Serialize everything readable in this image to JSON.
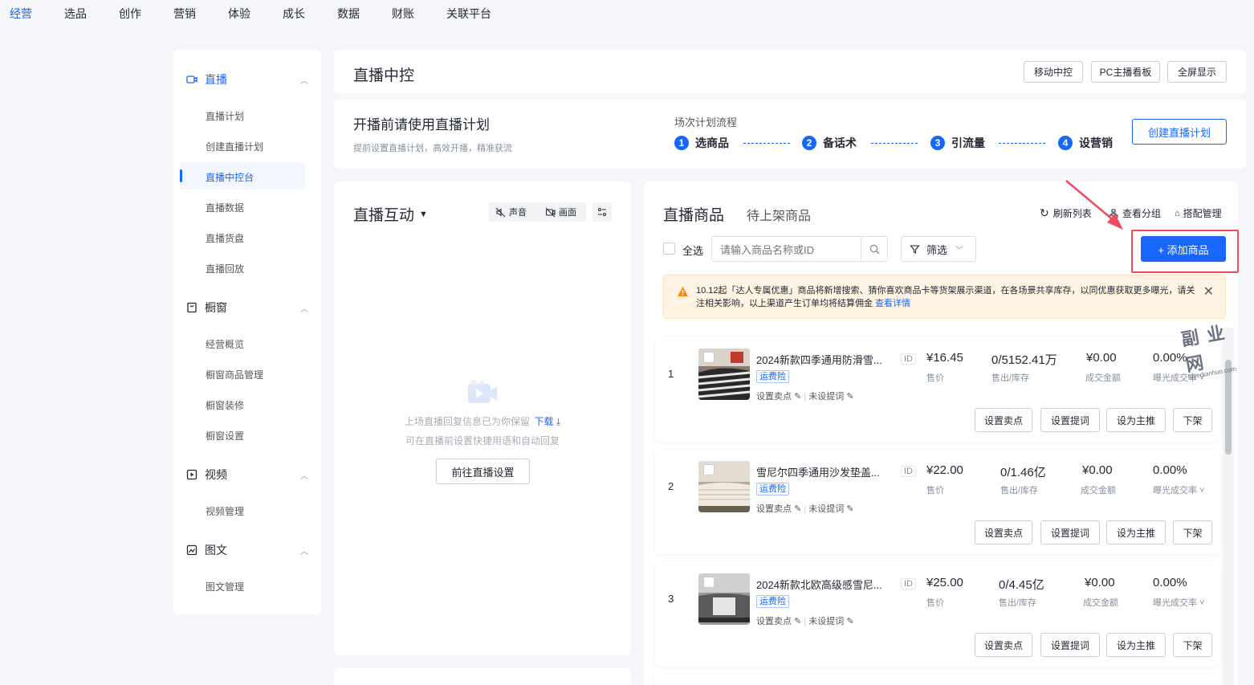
{
  "topnav": {
    "items": [
      {
        "label": "经营",
        "active": true
      },
      {
        "label": "选品"
      },
      {
        "label": "创作"
      },
      {
        "label": "营销"
      },
      {
        "label": "体验"
      },
      {
        "label": "成长"
      },
      {
        "label": "数据"
      },
      {
        "label": "财账"
      },
      {
        "label": "关联平台"
      }
    ]
  },
  "sidebar": {
    "groups": [
      {
        "label": "直播",
        "icon": "video-camera-icon",
        "items": [
          "直播计划",
          "创建直播计划",
          "直播中控台",
          "直播数据",
          "直播货盘",
          "直播回放"
        ]
      },
      {
        "label": "橱窗",
        "icon": "shop-window-icon",
        "items": [
          "经营概览",
          "橱窗商品管理",
          "橱窗装修",
          "橱窗设置"
        ]
      },
      {
        "label": "视频",
        "icon": "video-play-icon",
        "items": [
          "视频管理"
        ]
      },
      {
        "label": "图文",
        "icon": "image-text-icon",
        "items": [
          "图文管理"
        ]
      }
    ],
    "active_item": "直播中控台"
  },
  "header": {
    "title": "直播中控",
    "buttons": [
      "移动中控",
      "PC主播看板",
      "全屏显示"
    ]
  },
  "plan": {
    "title": "开播前请使用直播计划",
    "subtitle": "提前设置直播计划，高效开播，精准获流",
    "flow_label": "场次计划流程",
    "steps": [
      {
        "num": "1",
        "label": "选商品"
      },
      {
        "num": "2",
        "label": "备话术"
      },
      {
        "num": "3",
        "label": "引流量"
      },
      {
        "num": "4",
        "label": "设营销"
      }
    ],
    "create_button": "创建直播计划"
  },
  "interaction": {
    "title": "直播互动",
    "sound_label": "声音",
    "picture_label": "画面",
    "empty_line1": "上场直播回复信息已为你保留",
    "download_label": "下载",
    "empty_line2": "可在直播前设置快捷用语和自动回复",
    "goto_button": "前往直播设置"
  },
  "goods": {
    "tab_active": "直播商品",
    "tab_other": "待上架商品",
    "refresh_label": "刷新列表",
    "group_label": "查看分组",
    "match_label": "搭配管理",
    "select_all": "全选",
    "search_placeholder": "请输入商品名称或ID",
    "filter_label": "筛选",
    "add_button": "+ 添加商品",
    "notice_text": "10.12起「达人专属优惠」商品将新增搜索、猜你喜欢商品卡等货架展示渠道，在各场景共享库存，以同优惠获取更多曝光，请关注相关影响，以上渠道产生订单均将结算佣金",
    "notice_link": "查看详情",
    "stat_labels": {
      "price": "售价",
      "sold": "售出/库存",
      "deal": "成交金额",
      "rate": "曝光成交率"
    },
    "row_tag": "运费险",
    "row_sub1": "设置卖点",
    "row_sub2": "未设提词",
    "id_label": "ID",
    "actions": [
      "设置卖点",
      "设置提词",
      "设为主推",
      "下架"
    ],
    "products": [
      {
        "index": "1",
        "title": "2024新款四季通用防滑雪...",
        "price": "¥16.45",
        "sold": "0/5152.41万",
        "deal": "¥0.00",
        "rate": "0.00%"
      },
      {
        "index": "2",
        "title": "雪尼尔四季通用沙发垫盖...",
        "price": "¥22.00",
        "sold": "0/1.46亿",
        "deal": "¥0.00",
        "rate": "0.00%"
      },
      {
        "index": "3",
        "title": "2024新款北欧高级感雪尼...",
        "price": "¥25.00",
        "sold": "0/4.45亿",
        "deal": "¥0.00",
        "rate": "0.00%"
      }
    ]
  },
  "watermark": {
    "main": "副 业 网",
    "sub": "fuyedianhuo.com"
  },
  "colors": {
    "accent": "#1966ff",
    "highlight": "#ef4b5f",
    "notice_bg": "#fff4e3",
    "warning": "#ff8800"
  }
}
